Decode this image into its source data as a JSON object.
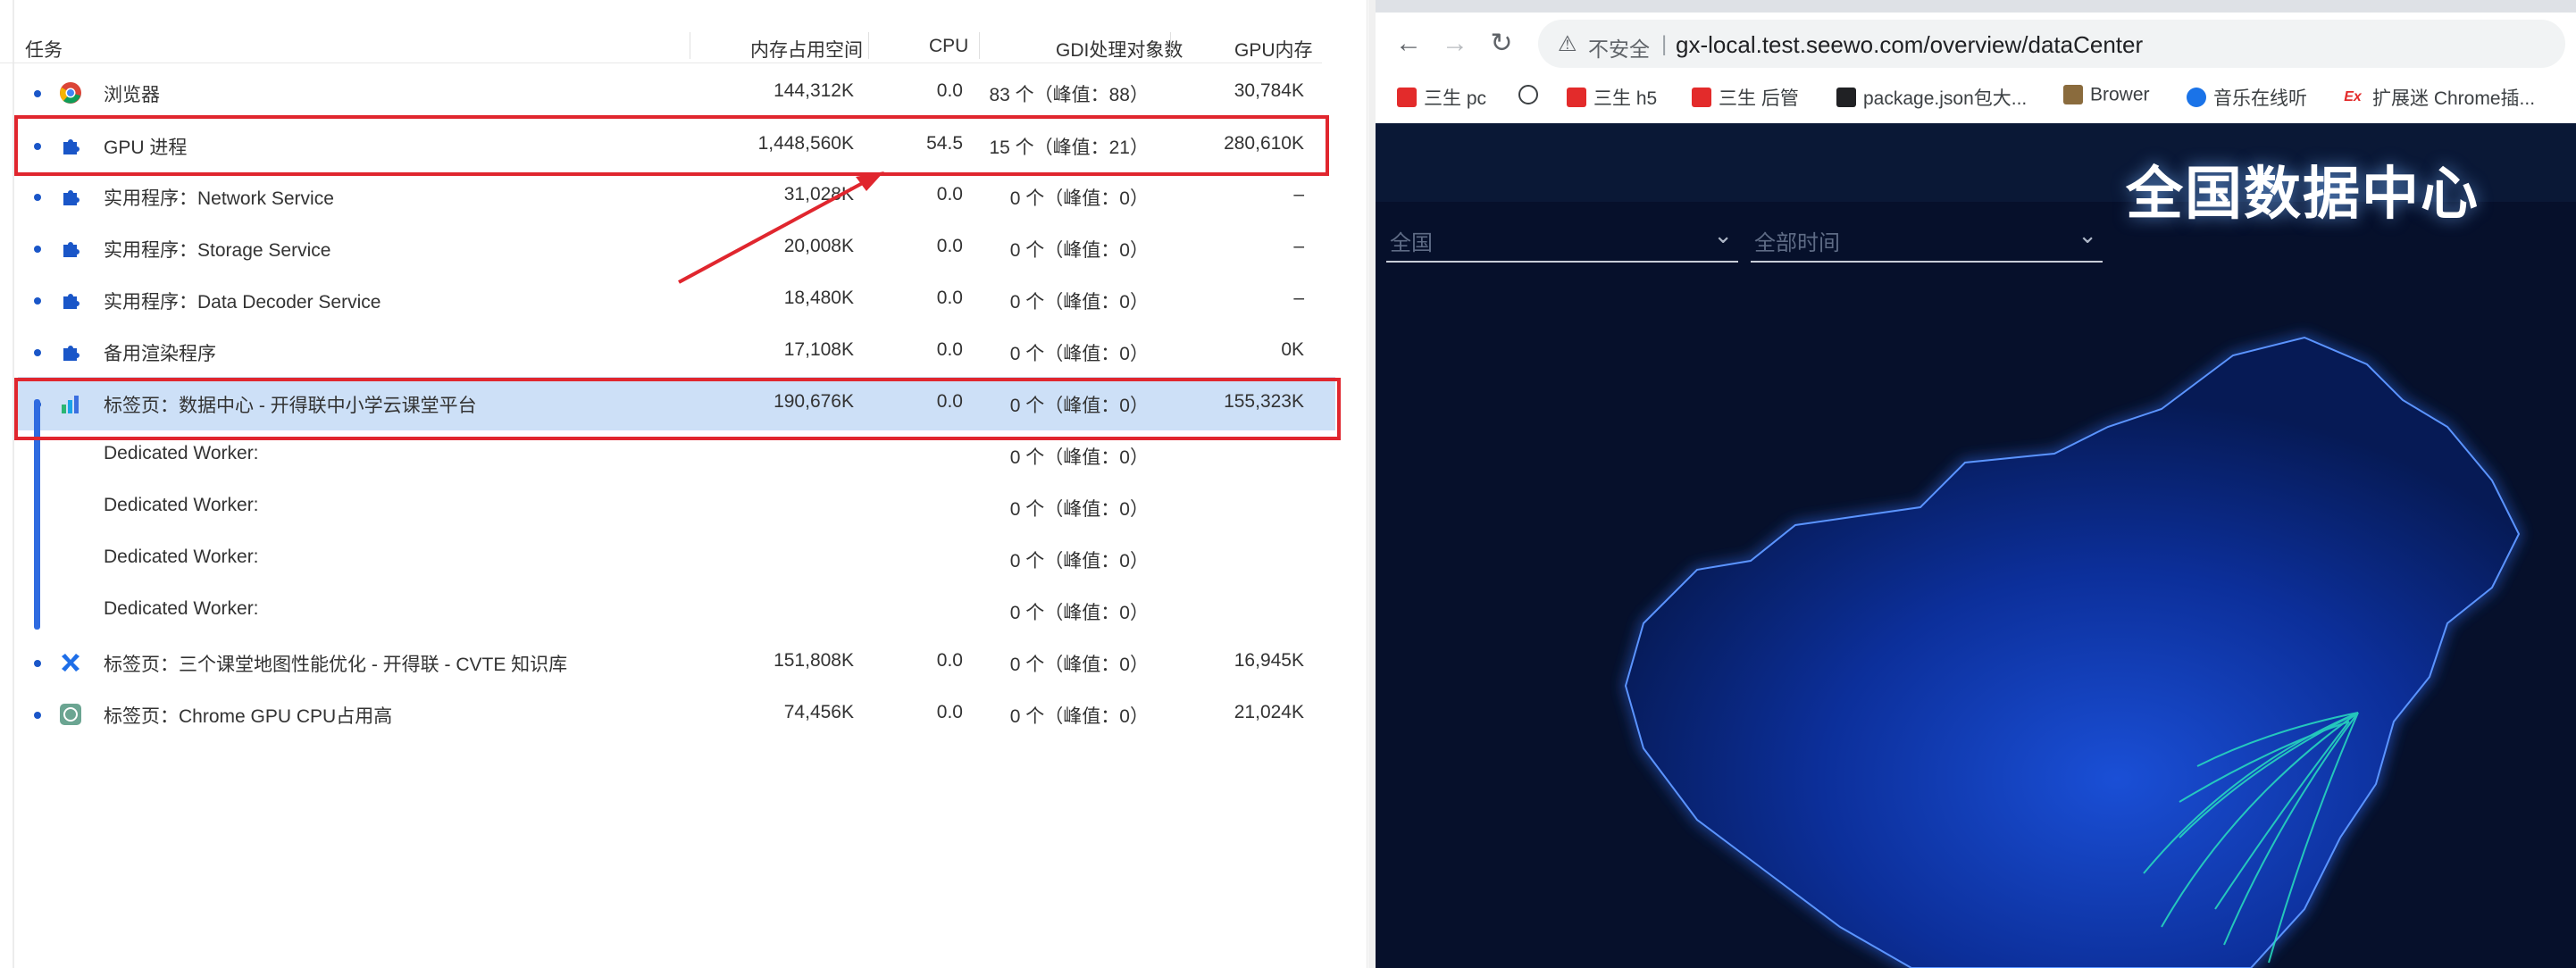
{
  "task_manager": {
    "headers": {
      "task": "任务",
      "memory": "内存占用空间",
      "cpu": "CPU",
      "gdi": "GDI处理对象数",
      "gpu": "GPU内存"
    },
    "rows": [
      {
        "name": "浏览器",
        "mem": "144,312K",
        "cpu": "0.0",
        "gdi": "83 个（峰值：88）",
        "gpu": "30,784K"
      },
      {
        "name": "GPU 进程",
        "mem": "1,448,560K",
        "cpu": "54.5",
        "gdi": "15 个（峰值：21）",
        "gpu": "280,610K"
      },
      {
        "name": "实用程序：Network Service",
        "mem": "31,028K",
        "cpu": "0.0",
        "gdi": "0 个（峰值：0）",
        "gpu": "–"
      },
      {
        "name": "实用程序：Storage Service",
        "mem": "20,008K",
        "cpu": "0.0",
        "gdi": "0 个（峰值：0）",
        "gpu": "–"
      },
      {
        "name": "实用程序：Data Decoder Service",
        "mem": "18,480K",
        "cpu": "0.0",
        "gdi": "0 个（峰值：0）",
        "gpu": "–"
      },
      {
        "name": "备用渲染程序",
        "mem": "17,108K",
        "cpu": "0.0",
        "gdi": "0 个（峰值：0）",
        "gpu": "0K"
      },
      {
        "name": "标签页：数据中心 - 开得联中小学云课堂平台",
        "mem": "190,676K",
        "cpu": "0.0",
        "gdi": "0 个（峰值：0）",
        "gpu": "155,323K"
      },
      {
        "name": "Dedicated Worker:",
        "mem": "",
        "cpu": "",
        "gdi": "0 个（峰值：0）",
        "gpu": ""
      },
      {
        "name": "Dedicated Worker:",
        "mem": "",
        "cpu": "",
        "gdi": "0 个（峰值：0）",
        "gpu": ""
      },
      {
        "name": "Dedicated Worker:",
        "mem": "",
        "cpu": "",
        "gdi": "0 个（峰值：0）",
        "gpu": ""
      },
      {
        "name": "Dedicated Worker:",
        "mem": "",
        "cpu": "",
        "gdi": "0 个（峰值：0）",
        "gpu": ""
      },
      {
        "name": "标签页：三个课堂地图性能优化 - 开得联 - CVTE 知识库",
        "mem": "151,808K",
        "cpu": "0.0",
        "gdi": "0 个（峰值：0）",
        "gpu": "16,945K"
      },
      {
        "name": "标签页：Chrome GPU CPU占用高",
        "mem": "74,456K",
        "cpu": "0.0",
        "gdi": "0 个（峰值：0）",
        "gpu": "21,024K"
      }
    ],
    "highlight_color": "#e0262e",
    "selected_color": "#cde0f7"
  },
  "browser": {
    "security_label": "不安全",
    "url": "gx-local.test.seewo.com/overview/dataCenter",
    "bookmarks": [
      "三生 pc",
      "三生 h5",
      "三生 后管",
      "package.json包大...",
      "Brower",
      "音乐在线听",
      "扩展迷 Chrome插..."
    ],
    "page": {
      "title": "全国数据中心",
      "select1": "全国",
      "select2": "全部时间"
    }
  }
}
